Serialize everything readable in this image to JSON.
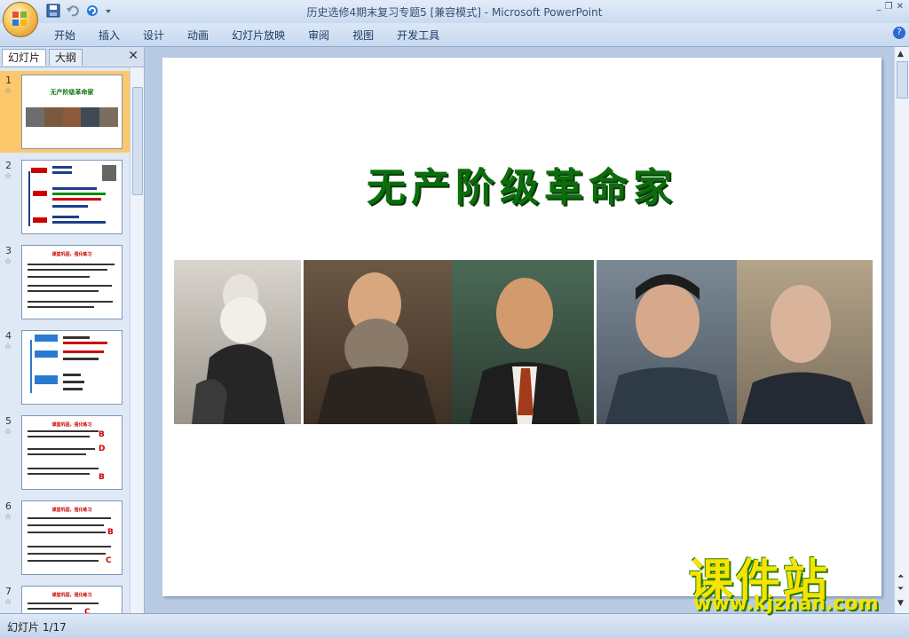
{
  "window": {
    "title": "历史选修4期末复习专题5 [兼容模式] - Microsoft PowerPoint",
    "minimize": "_",
    "restore": "❐",
    "close": "✕"
  },
  "ribbon": {
    "tabs": [
      "开始",
      "插入",
      "设计",
      "动画",
      "幻灯片放映",
      "审阅",
      "视图",
      "开发工具"
    ],
    "help": "?"
  },
  "pane": {
    "tab_slides": "幻灯片",
    "tab_outline": "大纲",
    "close": "✕",
    "thumbnails": [
      {
        "num": "1",
        "title": "无产阶级革命家"
      },
      {
        "num": "2"
      },
      {
        "num": "3",
        "head": "课堂巩固，强化练习"
      },
      {
        "num": "4"
      },
      {
        "num": "5",
        "head": "课堂巩固，强化练习",
        "answers": [
          "B",
          "D",
          "B"
        ]
      },
      {
        "num": "6",
        "head": "课堂巩固，强化练习",
        "answers": [
          "B",
          "C"
        ]
      },
      {
        "num": "7",
        "head": "课堂巩固，强化练习",
        "answers": [
          "C"
        ]
      }
    ]
  },
  "slide": {
    "title": "无产阶级革命家"
  },
  "status": {
    "slide_counter": "幻灯片 1/17"
  },
  "watermark": {
    "text": "课件站",
    "url": "www.kjzhan.com"
  },
  "colors": {
    "title_green": "#0a6e0a",
    "selected_thumb": "#fbc86b",
    "watermark_yellow": "#f6e400"
  }
}
